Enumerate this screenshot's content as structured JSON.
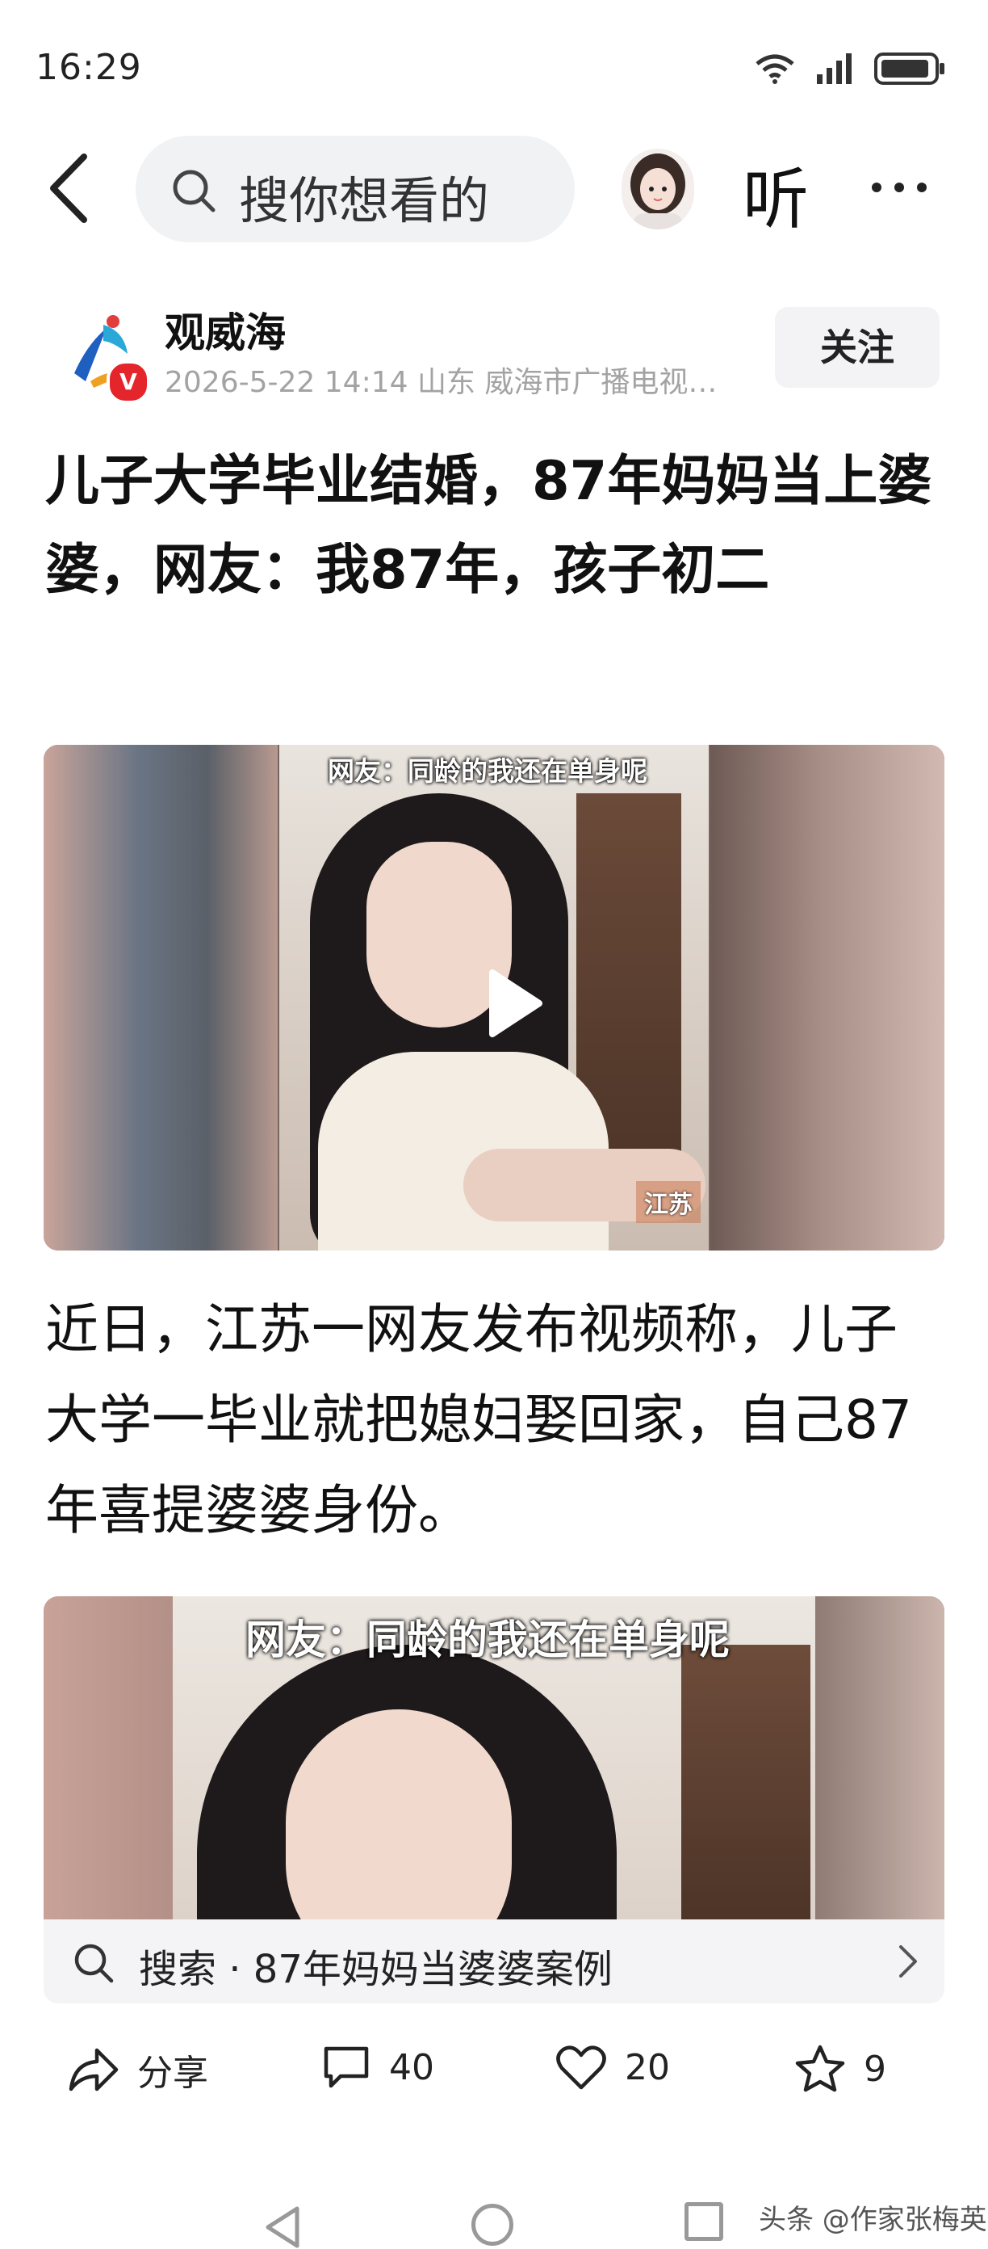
{
  "status": {
    "time": "16:29"
  },
  "topbar": {
    "search_placeholder": "搜你想看的",
    "listen_label": "听"
  },
  "author": {
    "name": "观威海",
    "badge": "V",
    "meta": "2026-5-22  14:14  山东  威海市广播电视…",
    "follow_label": "关注"
  },
  "article": {
    "title": "儿子大学毕业结婚，87年妈妈当上婆婆，网友：我87年，孩子初二",
    "video_caption": "网友：同龄的我还在单身呢",
    "video_location": "江苏",
    "paragraph": "近日，江苏一网友发布视频称，儿子大学一毕业就把媳妇娶回家，自己87年喜提婆婆身份。",
    "image_caption": "网友：同龄的我还在单身呢"
  },
  "search_suggestion": "搜索 · 87年妈妈当婆婆案例",
  "actions": {
    "share_label": "分享",
    "comments": "40",
    "likes": "20",
    "favorites": "9"
  },
  "watermark": "头条 @作家张梅英",
  "colors": {
    "badge": "#e4252c",
    "follow_bg": "#f3f3f5",
    "search_bg": "#f1f2f4"
  }
}
